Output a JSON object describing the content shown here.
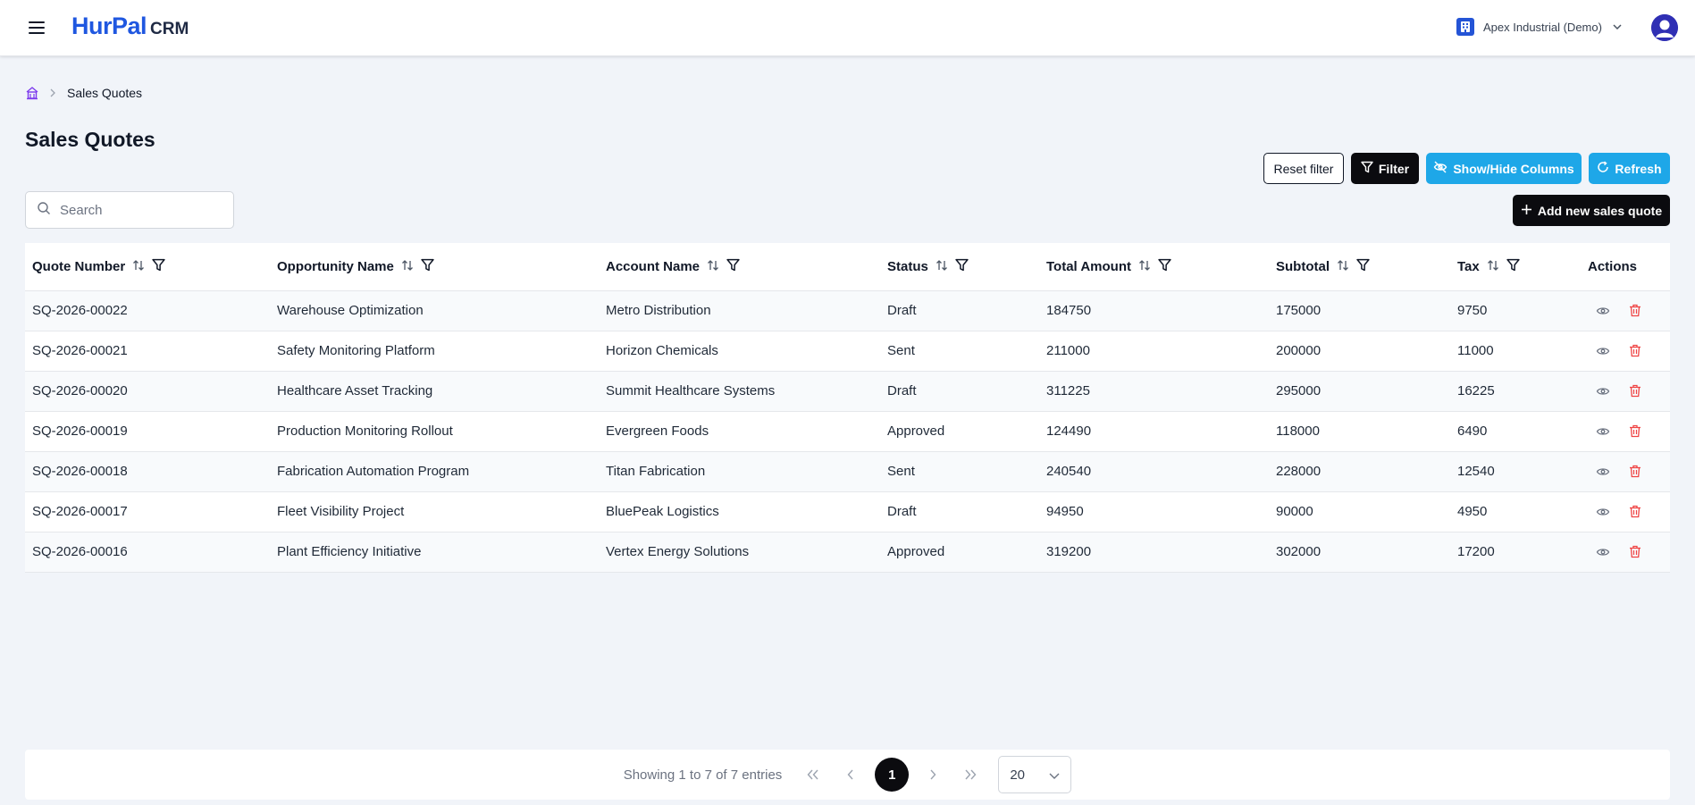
{
  "header": {
    "brand_main": "HurPal",
    "brand_sub": "CRM",
    "organization": "Apex Industrial (Demo)"
  },
  "breadcrumb": {
    "current": "Sales Quotes"
  },
  "page": {
    "title": "Sales Quotes"
  },
  "toolbar": {
    "reset_label": "Reset filter",
    "filter_label": "Filter",
    "columns_label": "Show/Hide Columns",
    "refresh_label": "Refresh",
    "add_label": "Add new sales quote"
  },
  "search": {
    "placeholder": "Search",
    "value": ""
  },
  "table": {
    "columns": [
      {
        "label": "Quote Number",
        "sortable": true,
        "filterable": true
      },
      {
        "label": "Opportunity Name",
        "sortable": true,
        "filterable": true
      },
      {
        "label": "Account Name",
        "sortable": true,
        "filterable": true
      },
      {
        "label": "Status",
        "sortable": true,
        "filterable": true
      },
      {
        "label": "Total Amount",
        "sortable": true,
        "filterable": true
      },
      {
        "label": "Subtotal",
        "sortable": true,
        "filterable": true
      },
      {
        "label": "Tax",
        "sortable": true,
        "filterable": true
      },
      {
        "label": "Actions",
        "sortable": false,
        "filterable": false
      }
    ],
    "rows": [
      [
        "SQ-2026-00022",
        "Warehouse Optimization",
        "Metro Distribution",
        "Draft",
        "184750",
        "175000",
        "9750"
      ],
      [
        "SQ-2026-00021",
        "Safety Monitoring Platform",
        "Horizon Chemicals",
        "Sent",
        "211000",
        "200000",
        "11000"
      ],
      [
        "SQ-2026-00020",
        "Healthcare Asset Tracking",
        "Summit Healthcare Systems",
        "Draft",
        "311225",
        "295000",
        "16225"
      ],
      [
        "SQ-2026-00019",
        "Production Monitoring Rollout",
        "Evergreen Foods",
        "Approved",
        "124490",
        "118000",
        "6490"
      ],
      [
        "SQ-2026-00018",
        "Fabrication Automation Program",
        "Titan Fabrication",
        "Sent",
        "240540",
        "228000",
        "12540"
      ],
      [
        "SQ-2026-00017",
        "Fleet Visibility Project",
        "BluePeak Logistics",
        "Draft",
        "94950",
        "90000",
        "4950"
      ],
      [
        "SQ-2026-00016",
        "Plant Efficiency Initiative",
        "Vertex Energy Solutions",
        "Approved",
        "319200",
        "302000",
        "17200"
      ]
    ]
  },
  "pagination": {
    "info": "Showing 1 to 7 of 7 entries",
    "current_page": "1",
    "page_size": "20"
  },
  "icons": {
    "menu": "hamburger-icon",
    "org": "building-icon",
    "home": "home-icon",
    "sort": "sort-icon",
    "filter": "filter-icon",
    "view": "eye-icon",
    "delete": "trash-icon"
  },
  "colors": {
    "brand": "#1f57e0",
    "accent": "#1ea7e8",
    "dark_button": "#0b0b0f",
    "delete": "#ef4444",
    "background": "#f1f4f9"
  }
}
